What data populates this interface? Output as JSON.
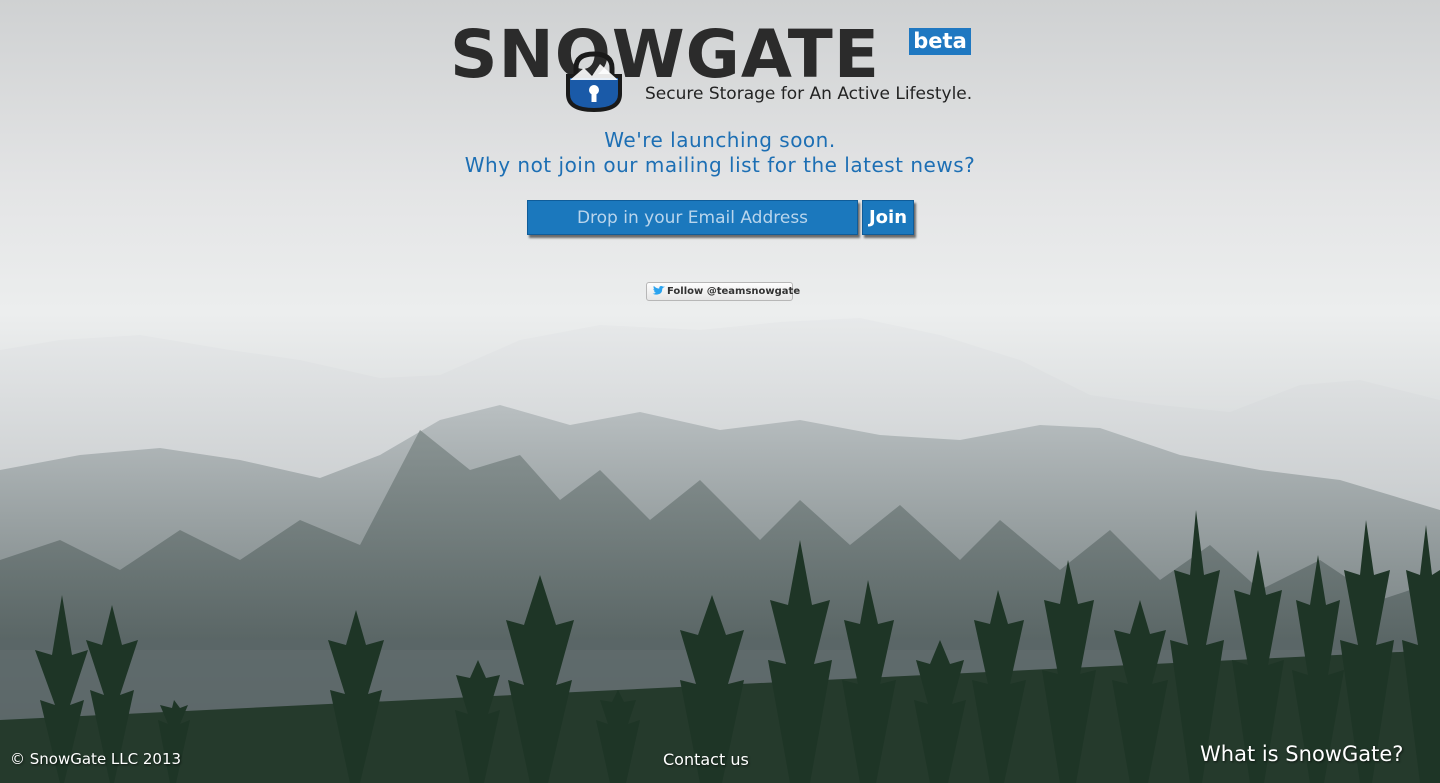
{
  "brand": {
    "name": "SNOWGATE",
    "badge": "beta",
    "tagline": "Secure Storage for An Active Lifestyle.",
    "colors": {
      "accent": "#1b78bd",
      "badge": "#1f78c1",
      "text_dark": "#2b2b2b",
      "announce": "#1d6fb4"
    }
  },
  "announcement": {
    "line1": "We're launching soon.",
    "line2": "Why not join our mailing list for the latest news?"
  },
  "signup": {
    "email_placeholder": "Drop in your Email Address",
    "email_value": "",
    "join_label": "Join"
  },
  "social": {
    "follow_label": "Follow @teamsnowgate",
    "icon": "twitter-bird-icon"
  },
  "footer": {
    "copyright": "© SnowGate LLC 2013",
    "contact": "Contact us",
    "what_is": "What is SnowGate?"
  }
}
